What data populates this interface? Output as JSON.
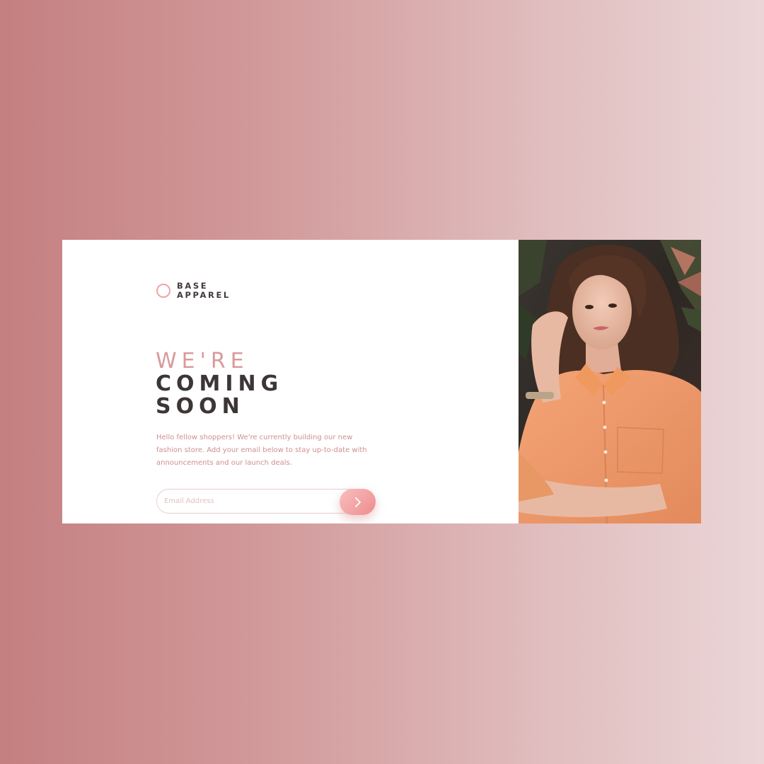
{
  "brand": {
    "line1": "BASE",
    "line2": "APPAREL",
    "accent_color": "#f1a3a6"
  },
  "hero": {
    "light_word": "WE'RE",
    "dark_line1": "COMING",
    "dark_line2": "SOON"
  },
  "description": "Hello fellow shoppers! We're currently building our new fashion store. Add your email below to stay up-to-date with announcements and our launch deals.",
  "form": {
    "email_placeholder": "Email Address",
    "email_value": "",
    "submit_icon": "arrow-right-icon"
  },
  "photo": {
    "icon": "hero-image"
  },
  "colors": {
    "background_start": "#c47f80",
    "background_end": "#ebd6d7",
    "headline_light": "#d99a9c",
    "headline_dark": "#3d3536",
    "body_text": "#cf8f90",
    "button_start": "#f8bfbf",
    "button_end": "#ee8c8d"
  }
}
